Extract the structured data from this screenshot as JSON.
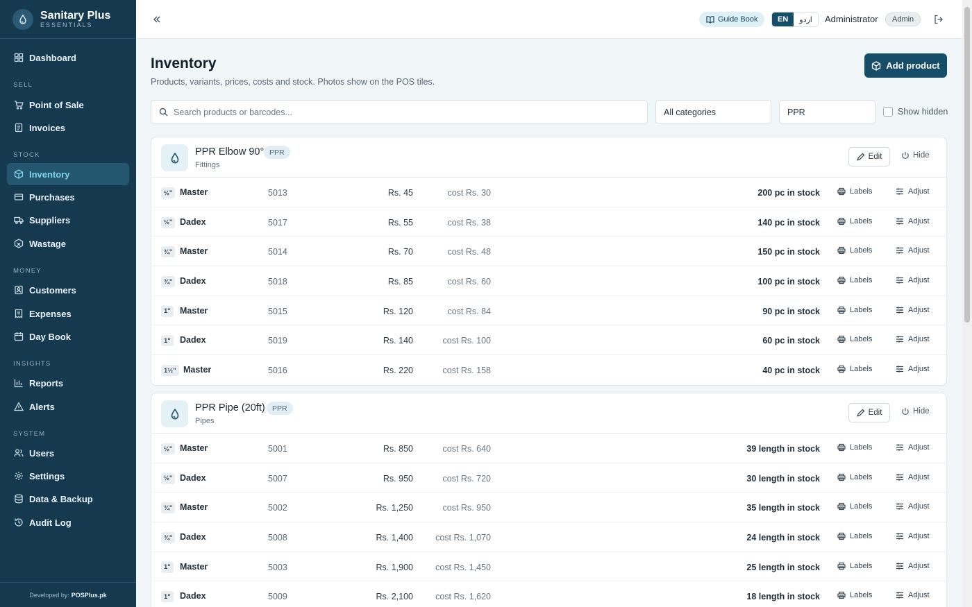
{
  "brand": {
    "name": "Sanitary Plus",
    "sub": "ESSENTIALS"
  },
  "nav": {
    "dashboard": "Dashboard",
    "sell_section": "SELL",
    "pos": "Point of Sale",
    "invoices": "Invoices",
    "stock_section": "STOCK",
    "inventory": "Inventory",
    "purchases": "Purchases",
    "suppliers": "Suppliers",
    "wastage": "Wastage",
    "money_section": "MONEY",
    "customers": "Customers",
    "expenses": "Expenses",
    "daybook": "Day Book",
    "insights_section": "INSIGHTS",
    "reports": "Reports",
    "alerts": "Alerts",
    "system_section": "SYSTEM",
    "users": "Users",
    "settings": "Settings",
    "backup": "Data & Backup",
    "audit": "Audit Log"
  },
  "footer": {
    "prefix": "Developed by:",
    "vendor": "POSPlus.pk"
  },
  "topbar": {
    "guide": "Guide Book",
    "lang_en": "EN",
    "lang_ur": "اردو",
    "user": "Administrator",
    "role": "Admin"
  },
  "page": {
    "title": "Inventory",
    "subtitle": "Products, variants, prices, costs and stock. Photos show on the POS tiles.",
    "add_label": "Add product"
  },
  "filters": {
    "search_placeholder": "Search products or barcodes...",
    "category": "All categories",
    "brand": "PPR",
    "show_hidden": "Show hidden"
  },
  "actions": {
    "edit": "Edit",
    "hide": "Hide",
    "labels": "Labels",
    "adjust": "Adjust"
  },
  "products": [
    {
      "name": "PPR Elbow 90°",
      "tag": "PPR",
      "category": "Fittings",
      "variants": [
        {
          "size": "½\"",
          "brand": "Master",
          "code": "5013",
          "price": "Rs. 45",
          "cost": "cost Rs. 30",
          "stock": "200 pc in stock"
        },
        {
          "size": "½\"",
          "brand": "Dadex",
          "code": "5017",
          "price": "Rs. 55",
          "cost": "cost Rs. 38",
          "stock": "140 pc in stock"
        },
        {
          "size": "¾\"",
          "brand": "Master",
          "code": "5014",
          "price": "Rs. 70",
          "cost": "cost Rs. 48",
          "stock": "150 pc in stock"
        },
        {
          "size": "¾\"",
          "brand": "Dadex",
          "code": "5018",
          "price": "Rs. 85",
          "cost": "cost Rs. 60",
          "stock": "100 pc in stock"
        },
        {
          "size": "1\"",
          "brand": "Master",
          "code": "5015",
          "price": "Rs. 120",
          "cost": "cost Rs. 84",
          "stock": "90 pc in stock"
        },
        {
          "size": "1\"",
          "brand": "Dadex",
          "code": "5019",
          "price": "Rs. 140",
          "cost": "cost Rs. 100",
          "stock": "60 pc in stock"
        },
        {
          "size": "1½\"",
          "brand": "Master",
          "code": "5016",
          "price": "Rs. 220",
          "cost": "cost Rs. 158",
          "stock": "40 pc in stock"
        }
      ]
    },
    {
      "name": "PPR Pipe (20ft)",
      "tag": "PPR",
      "category": "Pipes",
      "variants": [
        {
          "size": "½\"",
          "brand": "Master",
          "code": "5001",
          "price": "Rs. 850",
          "cost": "cost Rs. 640",
          "stock": "39 length in stock"
        },
        {
          "size": "½\"",
          "brand": "Dadex",
          "code": "5007",
          "price": "Rs. 950",
          "cost": "cost Rs. 720",
          "stock": "30 length in stock"
        },
        {
          "size": "¾\"",
          "brand": "Master",
          "code": "5002",
          "price": "Rs. 1,250",
          "cost": "cost Rs. 950",
          "stock": "35 length in stock"
        },
        {
          "size": "¾\"",
          "brand": "Dadex",
          "code": "5008",
          "price": "Rs. 1,400",
          "cost": "cost Rs. 1,070",
          "stock": "24 length in stock"
        },
        {
          "size": "1\"",
          "brand": "Master",
          "code": "5003",
          "price": "Rs. 1,900",
          "cost": "cost Rs. 1,450",
          "stock": "25 length in stock"
        },
        {
          "size": "1\"",
          "brand": "Dadex",
          "code": "5009",
          "price": "Rs. 2,100",
          "cost": "cost Rs. 1,620",
          "stock": "18 length in stock"
        }
      ]
    }
  ]
}
